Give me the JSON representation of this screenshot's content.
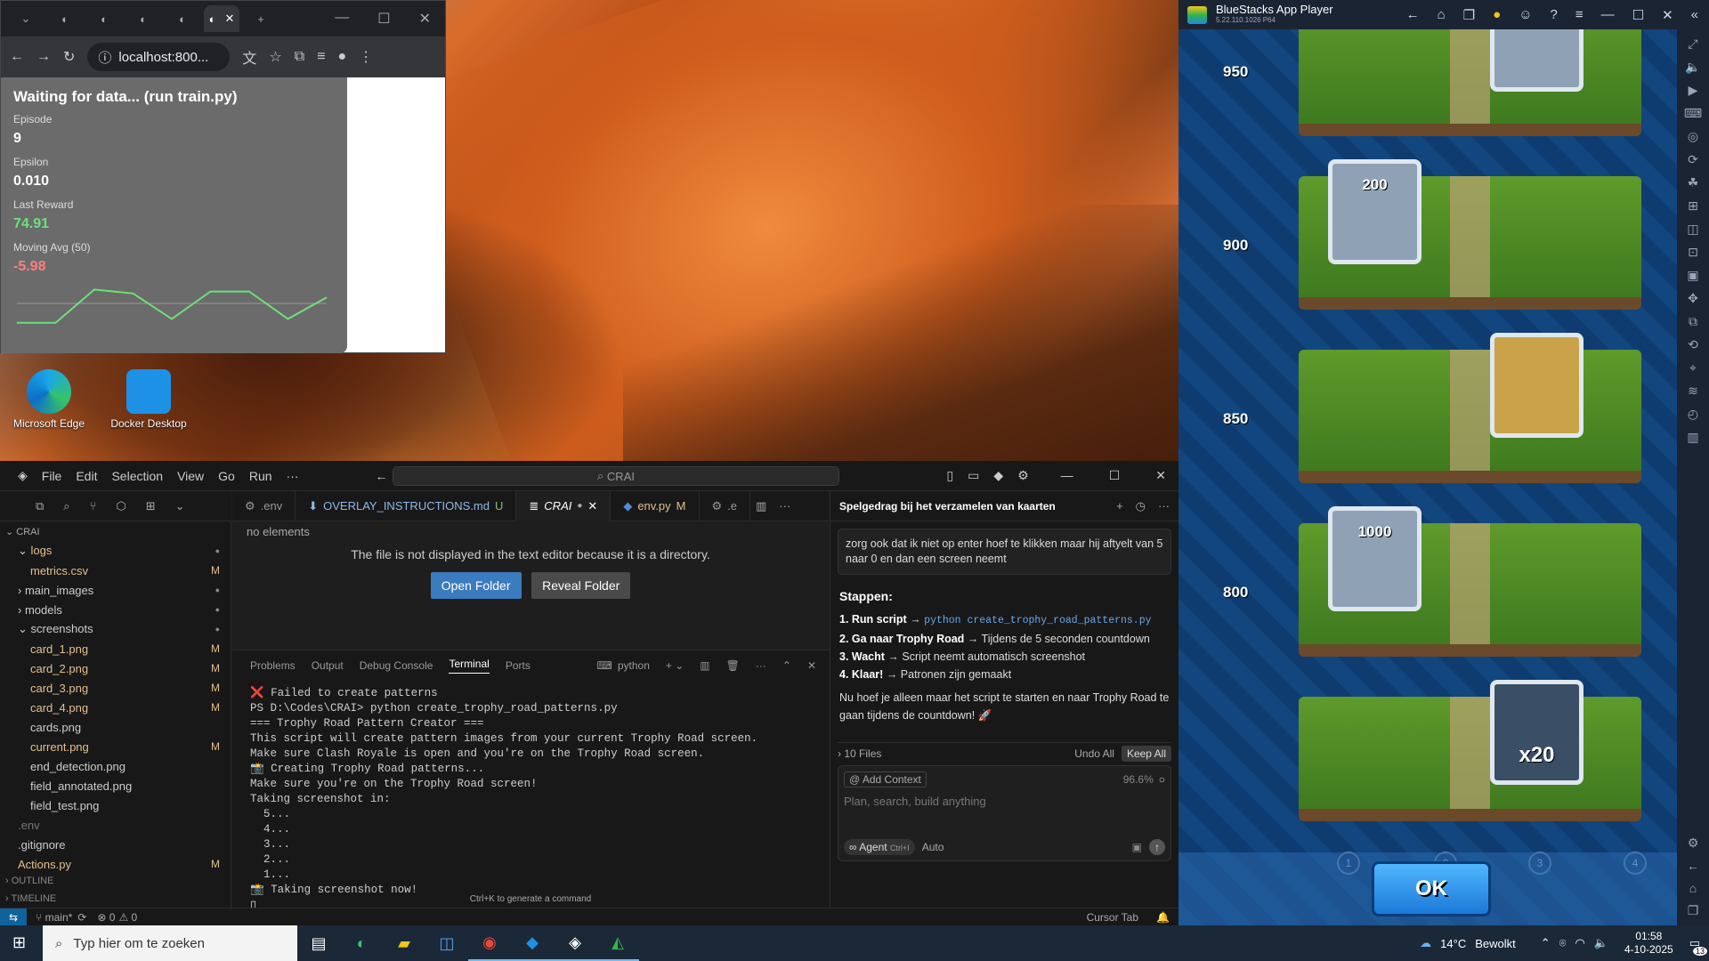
{
  "browser": {
    "url": "localhost:800...",
    "tab_close": "✕",
    "new_tab": "+"
  },
  "panel": {
    "title": "Waiting for data... (run train.py)",
    "episode_label": "Episode",
    "episode": "9",
    "epsilon_label": "Epsilon",
    "epsilon": "0.010",
    "last_reward_label": "Last Reward",
    "last_reward": "74.91",
    "moving_avg_label": "Moving Avg (50)",
    "moving_avg": "-5.98",
    "sparkline": [
      0.05,
      0.05,
      0.9,
      0.8,
      0.15,
      0.85,
      0.85,
      0.15,
      0.7
    ],
    "colors": {
      "positive": "#6ee07a",
      "negative": "#ff7f7f"
    }
  },
  "desktop": {
    "icons": [
      {
        "label": "Microsoft Edge"
      },
      {
        "label": "Docker Desktop"
      }
    ]
  },
  "bluestacks": {
    "title": "BlueStacks App Player",
    "version": "5.22.110.1026  P64",
    "levels": [
      "950",
      "900",
      "850",
      "800"
    ],
    "rewards": [
      "200",
      "1000",
      "x20"
    ],
    "pages": [
      "1",
      "2",
      "3",
      "4"
    ],
    "ok": "OK"
  },
  "vscode": {
    "menu": [
      "File",
      "Edit",
      "Selection",
      "View",
      "Go",
      "Run",
      "···"
    ],
    "search": "CRAI",
    "tabs": [
      {
        "label": ".env",
        "state": ""
      },
      {
        "label": "OVERLAY_INSTRUCTIONS.md",
        "state": "U"
      },
      {
        "label": "CRAI",
        "state": "●"
      },
      {
        "label": "env.py",
        "state": "M"
      },
      {
        "label": ".e",
        "state": ""
      }
    ],
    "editor": {
      "no_elements": "no elements",
      "message": "The file is not displayed in the text editor because it is a directory.",
      "open_folder": "Open Folder",
      "reveal_folder": "Reveal Folder"
    },
    "explorer": {
      "root": "CRAI",
      "items": [
        {
          "name": "logs",
          "type": "folder-open",
          "badge": "dot",
          "color": "yellow",
          "indent": 1
        },
        {
          "name": "metrics.csv",
          "type": "file",
          "badge": "M",
          "color": "yellow",
          "indent": 2
        },
        {
          "name": "main_images",
          "type": "folder",
          "badge": "dot",
          "color": "normal",
          "indent": 1
        },
        {
          "name": "models",
          "type": "folder",
          "badge": "dot",
          "color": "normal",
          "indent": 1
        },
        {
          "name": "screenshots",
          "type": "folder-open",
          "badge": "dot",
          "color": "normal",
          "indent": 1
        },
        {
          "name": "card_1.png",
          "type": "file",
          "badge": "M",
          "color": "yellow",
          "indent": 2
        },
        {
          "name": "card_2.png",
          "type": "file",
          "badge": "M",
          "color": "yellow",
          "indent": 2
        },
        {
          "name": "card_3.png",
          "type": "file",
          "badge": "M",
          "color": "yellow",
          "indent": 2
        },
        {
          "name": "card_4.png",
          "type": "file",
          "badge": "M",
          "color": "yellow",
          "indent": 2
        },
        {
          "name": "cards.png",
          "type": "file",
          "badge": "",
          "color": "normal",
          "indent": 2
        },
        {
          "name": "current.png",
          "type": "file",
          "badge": "M",
          "color": "yellow",
          "indent": 2
        },
        {
          "name": "end_detection.png",
          "type": "file",
          "badge": "",
          "color": "normal",
          "indent": 2
        },
        {
          "name": "field_annotated.png",
          "type": "file",
          "badge": "",
          "color": "normal",
          "indent": 2
        },
        {
          "name": "field_test.png",
          "type": "file",
          "badge": "",
          "color": "normal",
          "indent": 2
        },
        {
          "name": ".env",
          "type": "file",
          "badge": "",
          "color": "dim",
          "indent": 1
        },
        {
          "name": ".gitignore",
          "type": "file",
          "badge": "",
          "color": "normal",
          "indent": 1
        },
        {
          "name": "Actions.py",
          "type": "file",
          "badge": "M",
          "color": "yellow",
          "indent": 1
        }
      ],
      "outline": "OUTLINE",
      "timeline": "TIMELINE"
    },
    "terminal": {
      "tabs": [
        "Problems",
        "Output",
        "Debug Console",
        "Terminal",
        "Ports"
      ],
      "shell": "python",
      "lines": [
        "❌ Failed to create patterns",
        "PS D:\\Codes\\CRAI> python create_trophy_road_patterns.py",
        "=== Trophy Road Pattern Creator ===",
        "This script will create pattern images from your current Trophy Road screen.",
        "Make sure Clash Royale is open and you're on the Trophy Road screen.",
        "📸 Creating Trophy Road patterns...",
        "Make sure you're on the Trophy Road screen!",
        "Taking screenshot in:",
        "  5...",
        "  4...",
        "  3...",
        "  2...",
        "  1...",
        "📸 Taking screenshot now!"
      ],
      "hint": "Ctrl+K to generate a command"
    },
    "chat": {
      "title": "Spelgedrag bij het verzamelen van kaarten",
      "prompt": "zorg ook dat ik niet op enter hoef te klikken maar hij aftyelt van 5 naar 0 en dan een screen neemt",
      "heading": "Stappen:",
      "steps": [
        {
          "b": "1. Run script",
          "t": " → ",
          "code": "python create_trophy_road_patterns.py"
        },
        {
          "b": "2. Ga naar Trophy Road",
          "t": " → Tijdens de 5 seconden countdown",
          "code": ""
        },
        {
          "b": "3. Wacht",
          "t": " → Script neemt automatisch screenshot",
          "code": ""
        },
        {
          "b": "4. Klaar!",
          "t": " → Patronen zijn gemaakt",
          "code": ""
        }
      ],
      "outro": "Nu hoef je alleen maar het script te starten en naar Trophy Road te gaan tijdens de countdown! 🚀",
      "files": "10 Files",
      "undo_all": "Undo All",
      "keep_all": "Keep All",
      "add_context": "@ Add Context",
      "percent": "96.6%",
      "placeholder": "Plan, search, build anything",
      "agent": "∞ Agent",
      "agent_key": "Ctrl+I",
      "auto": "Auto"
    },
    "status": {
      "branch": "main*",
      "errors": "0",
      "warnings": "0",
      "cursor_tab": "Cursor Tab"
    }
  },
  "taskbar": {
    "search": "Typ hier om te zoeken",
    "weather_temp": "14°C",
    "weather_text": "Bewolkt",
    "time": "01:58",
    "date": "4-10-2025",
    "notif": "13"
  }
}
